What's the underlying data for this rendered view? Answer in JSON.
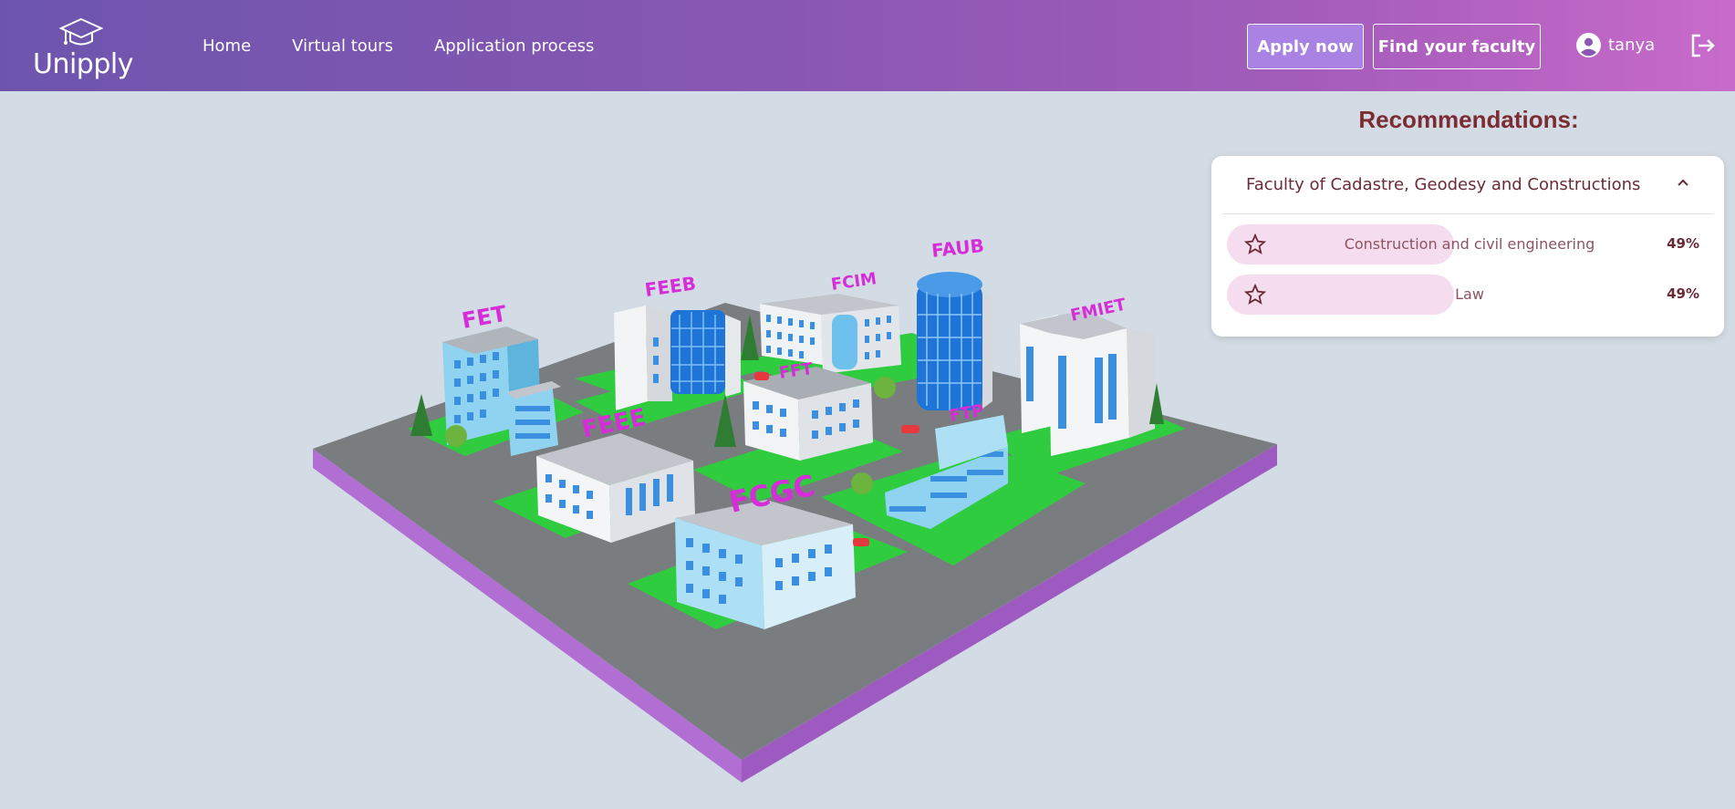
{
  "brand": {
    "name": "Unipply",
    "logo_icon": "graduation-cap-icon"
  },
  "nav": {
    "links": [
      "Home",
      "Virtual tours",
      "Application process"
    ]
  },
  "header": {
    "apply_label": "Apply now",
    "find_label": "Find your faculty",
    "username": "tanya",
    "user_icon": "account-circle-icon",
    "logout_icon": "logout-icon"
  },
  "recommendations": {
    "title": "Recommendations:",
    "faculty": "Faculty of Cadastre, Geodesy and Constructions",
    "items": [
      {
        "name": "Construction and civil engineering",
        "percent": "49%"
      },
      {
        "name": "Law",
        "percent": "49%"
      }
    ]
  },
  "campus": {
    "buildings": [
      "FET",
      "FEEB",
      "FCIM",
      "FAUB",
      "FMIET",
      "FFT",
      "FEEE",
      "FTP",
      "FCGC"
    ]
  },
  "colors": {
    "header_start": "#6d55ad",
    "header_end": "#c86acb",
    "apply_bg": "#a982e3",
    "accent_text": "#7b2d33",
    "label_magenta": "#d52ed8",
    "ground_green": "#2fcc3f",
    "road_gray": "#7a7d80",
    "platform_violet": "#c47be8"
  }
}
